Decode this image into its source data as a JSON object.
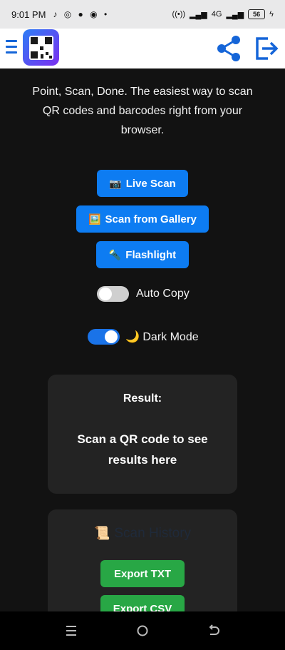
{
  "status_bar": {
    "time": "9:01 PM",
    "notification_icons": [
      "tiktok-icon",
      "whatsapp-icon",
      "chat-icon",
      "ball-icon",
      "dot"
    ],
    "network": "4G",
    "battery": "56"
  },
  "header": {
    "logo_alt": "QR code scanner logo",
    "icons": {
      "menu": "hamburger-icon",
      "share": "share-icon",
      "exit": "exit-icon"
    },
    "accent": "#1565d8"
  },
  "main": {
    "tagline": "Point, Scan, Done. The easiest way to scan QR codes and barcodes right from your browser.",
    "buttons": {
      "live_scan": {
        "icon": "📷",
        "label": "Live Scan"
      },
      "gallery": {
        "icon": "🖼️",
        "label": "Scan from Gallery"
      },
      "flashlight": {
        "icon": "🔦",
        "label": "Flashlight"
      }
    },
    "toggles": {
      "auto_copy": {
        "label": "Auto Copy",
        "on": false
      },
      "dark_mode": {
        "icon": "🌙",
        "label": "Dark Mode",
        "on": true
      }
    },
    "button_color": "#0d7cf2"
  },
  "result": {
    "title": "Result:",
    "text": "Scan a QR code to see results here"
  },
  "history": {
    "icon": "📜",
    "title": "Scan History",
    "export_txt": "Export TXT",
    "export_csv": "Export CSV",
    "button_color": "#28a745"
  },
  "navbar": {
    "icons": [
      "recents-icon",
      "home-icon",
      "back-icon"
    ]
  }
}
